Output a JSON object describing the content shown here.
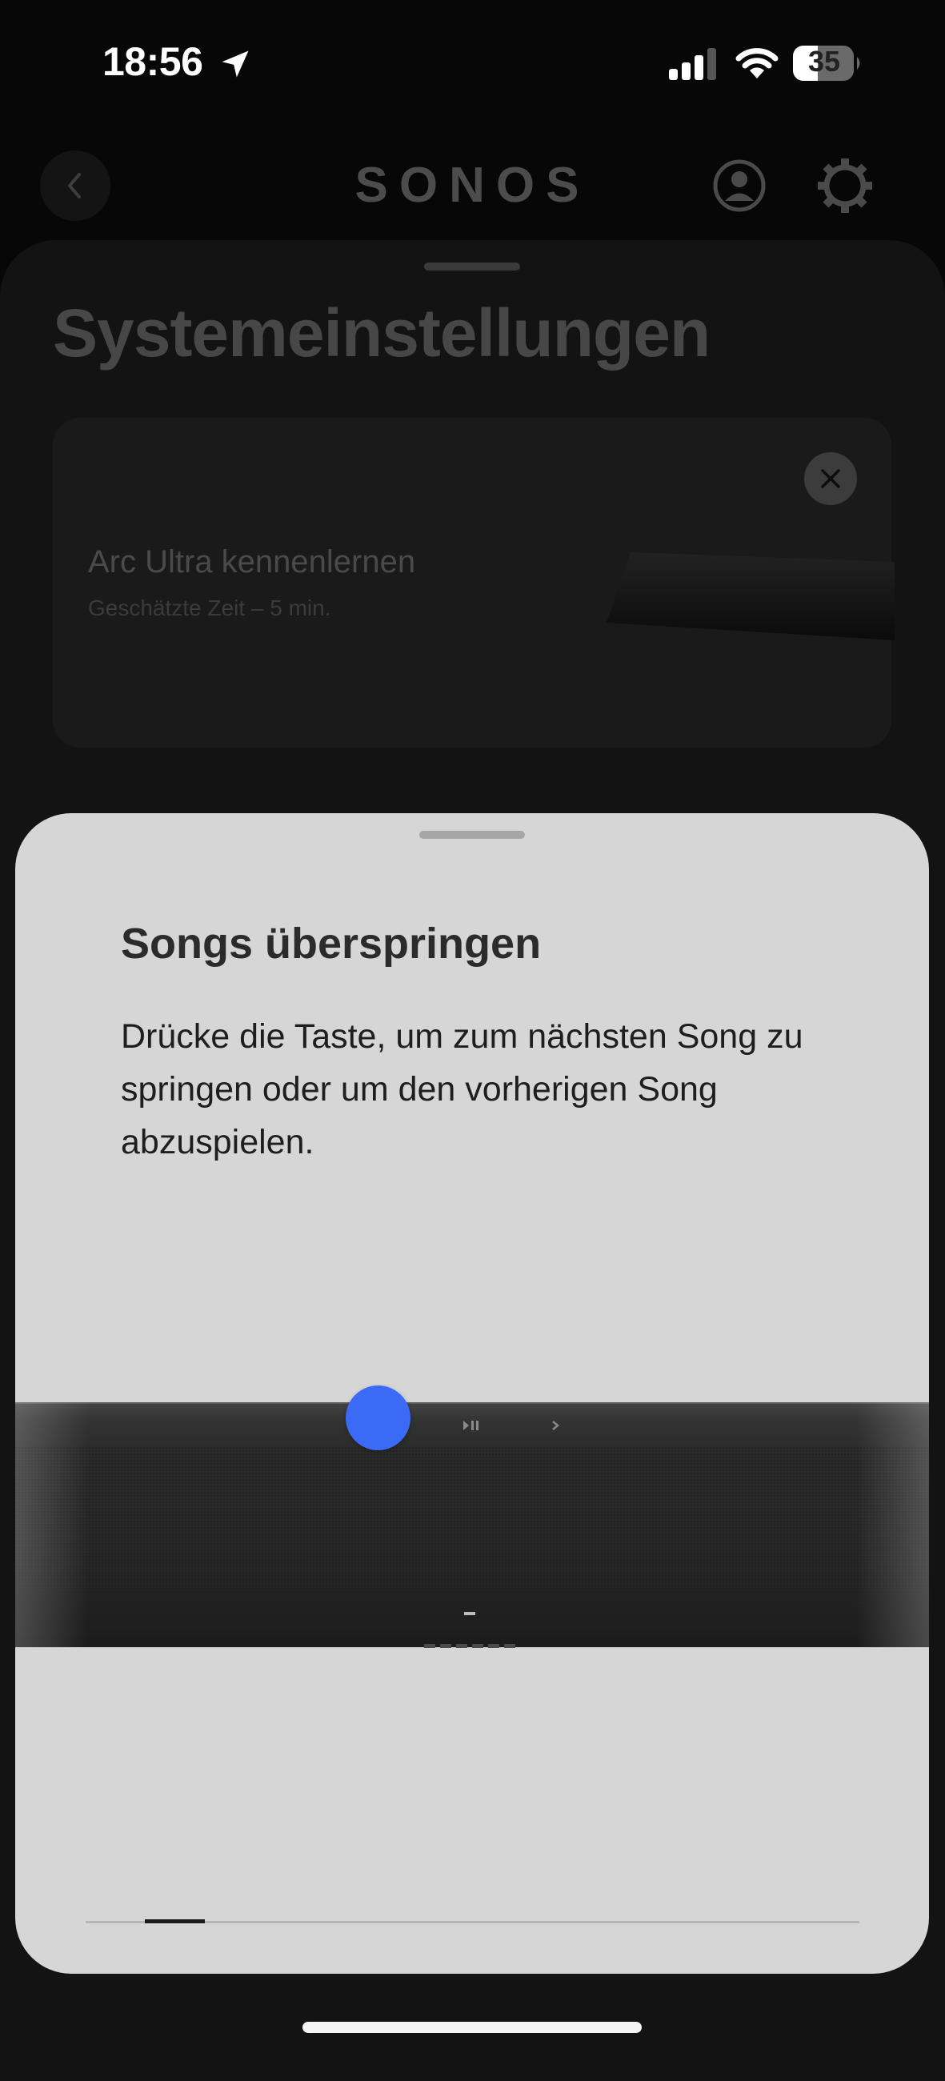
{
  "status_bar": {
    "time": "18:56",
    "battery": "35"
  },
  "app": {
    "logo": "SONOS"
  },
  "page": {
    "title": "Systemeinstellungen"
  },
  "promo": {
    "title": "Arc Ultra kennenlernen",
    "subtitle": "Geschätzte Zeit – 5 min."
  },
  "sheet": {
    "title": "Songs überspringen",
    "body": "Drücke die Taste, um zum nächsten Song zu springen oder um den vorherigen Song abzuspielen.",
    "progress": {
      "step": 2,
      "of": 13
    }
  },
  "colors": {
    "background": "#070707",
    "sheet": "#d6d6d6",
    "accent_dot": "#3b6bf6",
    "soundbar": "#262626"
  },
  "icons": [
    "location-arrow-icon",
    "signal-icon",
    "wifi-icon",
    "battery-icon",
    "chevron-left-icon",
    "account-icon",
    "gear-icon",
    "close-icon",
    "play-pause-icon",
    "next-icon"
  ]
}
